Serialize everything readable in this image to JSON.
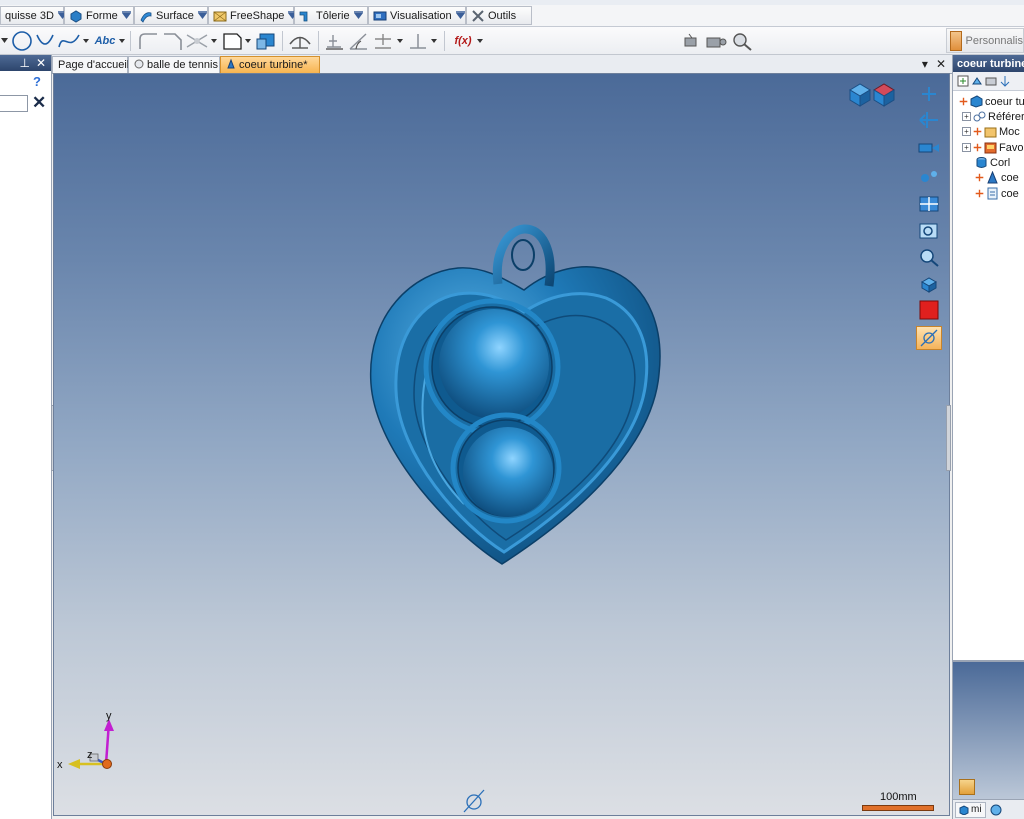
{
  "ribbon_tabs": [
    {
      "label": "quisse 3D"
    },
    {
      "label": "Forme"
    },
    {
      "label": "Surface"
    },
    {
      "label": "FreeShape"
    },
    {
      "label": "Tôlerie"
    },
    {
      "label": "Visualisation"
    },
    {
      "label": "Outils"
    }
  ],
  "toolbar": {
    "text_tool_label": "Abc",
    "formula_label": "f(x)",
    "personnal_label": "Personnalis"
  },
  "left_panel": {
    "pin_glyph": "⊥",
    "close_glyph": "✕",
    "help_glyph": "?",
    "delete_glyph": "✕"
  },
  "document_tabs": [
    {
      "label": "Page d'accueil",
      "active": false
    },
    {
      "label": "balle de tennis",
      "active": false
    },
    {
      "label": "coeur turbine*",
      "active": true
    }
  ],
  "viewport": {
    "triad": {
      "x": "x",
      "y": "y",
      "z": "z"
    },
    "scale_label": "100mm",
    "accent_color": "#2a86c6",
    "model_color": "#1e7ab8",
    "tool_colors": {
      "red_swatch": "#e0201e"
    }
  },
  "right_panel": {
    "title": "coeur turbine",
    "tree": [
      {
        "label": "coeur tu",
        "icon": "part-icon",
        "expander": ""
      },
      {
        "label": "Référer",
        "icon": "reference-icon",
        "expander": "+"
      },
      {
        "label": "Moc",
        "icon": "folder-icon",
        "expander": "+"
      },
      {
        "label": "Favo",
        "icon": "favorites-icon",
        "expander": "+"
      },
      {
        "label": "Corl",
        "icon": "body-icon",
        "expander": ""
      },
      {
        "label": "coe",
        "icon": "sketch-icon",
        "expander": ""
      },
      {
        "label": "coe",
        "icon": "document-icon",
        "expander": ""
      }
    ],
    "bottom_tab_label": "mi"
  }
}
